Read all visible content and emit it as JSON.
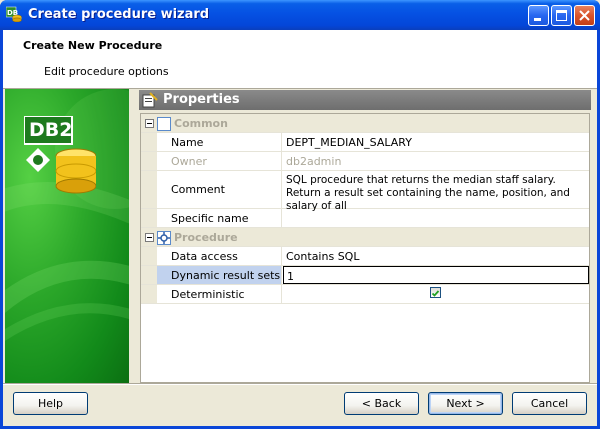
{
  "window": {
    "title": "Create procedure wizard",
    "title_bar_color": "#0A4FDB"
  },
  "header": {
    "title": "Create New Procedure",
    "subtitle": "Edit procedure options"
  },
  "side_logo": {
    "text": "DB2"
  },
  "properties": {
    "title": "Properties",
    "categories": [
      {
        "label": "Common",
        "rows": [
          {
            "name": "Name",
            "value": "DEPT_MEDIAN_SALARY"
          },
          {
            "name": "Owner",
            "value": "db2admin",
            "disabled": true
          },
          {
            "name": "Comment",
            "value": "SQL procedure that returns the median staff salary. Return a result set containing the name, position, and salary of all"
          },
          {
            "name": "Specific name",
            "value": ""
          }
        ]
      },
      {
        "label": "Procedure",
        "rows": [
          {
            "name": "Data access",
            "value": "Contains SQL"
          },
          {
            "name": "Dynamic result sets",
            "value": "1",
            "selected": true
          },
          {
            "name": "Deterministic",
            "value": "",
            "checked": true
          }
        ]
      }
    ]
  },
  "buttons": {
    "help": "Help",
    "back": "< Back",
    "next": "Next >",
    "cancel": "Cancel"
  },
  "colors": {
    "accent": "#0A46D8",
    "selection": "#C1D2EE",
    "side_green": "#2CA82A"
  }
}
